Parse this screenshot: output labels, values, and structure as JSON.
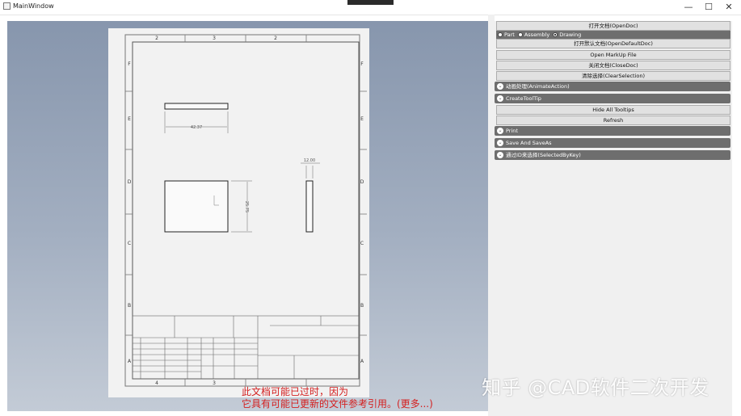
{
  "window": {
    "title": "MainWindow",
    "minimize": "—",
    "maximize": "☐",
    "close": "✕"
  },
  "drawing": {
    "top_zones": [
      "2",
      "3",
      "2"
    ],
    "bottom_zones": [
      "4",
      "3"
    ],
    "left_zones": [
      "F",
      "E",
      "D",
      "C",
      "B",
      "A"
    ],
    "right_zones": [
      "F",
      "E",
      "D",
      "C",
      "B",
      "A"
    ],
    "dims": {
      "top_width": "42.37",
      "front_height": "25.75",
      "side_width": "12.00"
    }
  },
  "notice": {
    "line1": "此文档可能已过时，因为",
    "line2": "它具有可能已更新的文件参考引用。(更多...)"
  },
  "panel": {
    "open_doc": "打开文档(OpenDoc)",
    "doc_types": {
      "part": "Part",
      "assembly": "Assembly",
      "drawing": "Drawing",
      "selected": "drawing"
    },
    "open_default_doc": "打开默认文档(OpenDefaultDoc)",
    "open_markup": "Open MarkUp File",
    "close_doc": "关闭文档(CloseDoc)",
    "clear_selection": "清除选择(ClearSelection)",
    "section_animate": "动画处理(AnimateAction)",
    "section_tooltip": "CreateToolTip",
    "hide_tooltips": "Hide All Tooltips",
    "refresh": "Refresh",
    "section_print": "Print",
    "section_save": "Save And SaveAs",
    "section_select": "通过ID来选择(SelectedByKey)"
  },
  "watermark": "知乎 @CAD软件二次开发"
}
